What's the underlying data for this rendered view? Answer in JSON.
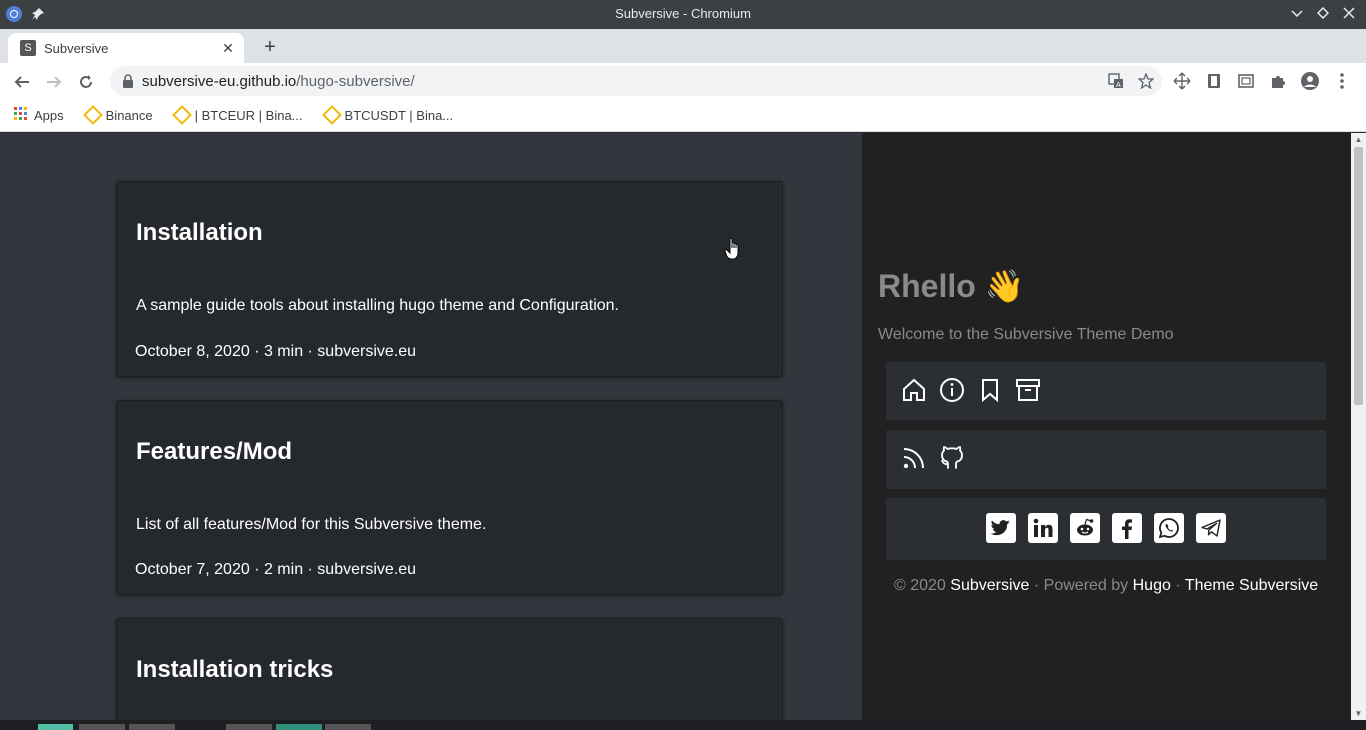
{
  "window": {
    "title": "Subversive - Chromium"
  },
  "tab": {
    "title": "Subversive",
    "favicon_letter": "S"
  },
  "address": {
    "host": "subversive-eu.github.io",
    "path": "/hugo-subversive/"
  },
  "bookmarks": [
    {
      "label": "Apps"
    },
    {
      "label": "Binance"
    },
    {
      "label": "| BTCEUR | Bina..."
    },
    {
      "label": "BTCUSDT | Bina..."
    }
  ],
  "posts": [
    {
      "title": "Installation",
      "description": "A sample guide tools about installing hugo theme and Configuration.",
      "meta": "October 8, 2020 · 3 min · subversive.eu"
    },
    {
      "title": "Features/Mod",
      "description": "List of all features/Mod for this Subversive theme.",
      "meta": "October 7, 2020 · 2 min · subversive.eu"
    },
    {
      "title": "Installation tricks"
    }
  ],
  "sidebar": {
    "heading": "Rhello 👋",
    "welcome": "Welcome to the Subversive Theme Demo",
    "footer": {
      "copyright": "© 2020",
      "site_link": "Subversive",
      "powered": "· Powered by",
      "hugo_link": "Hugo",
      "sep": "·",
      "theme_link": "Theme Subversive"
    }
  },
  "colors": {
    "page_bg": "#33363d",
    "card_bg": "#25282d",
    "sidebar_bg": "#212121",
    "muted_text": "#8a8a8a"
  }
}
